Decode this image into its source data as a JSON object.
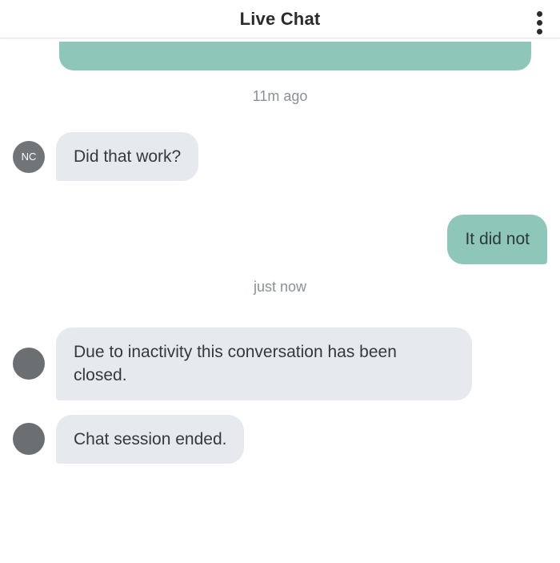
{
  "header": {
    "title": "Live Chat"
  },
  "timestamps": {
    "first": "11m ago",
    "second": "just now"
  },
  "avatars": {
    "agent_initials": "NC"
  },
  "messages": {
    "agent_q": "Did that work?",
    "user_reply": "It did not",
    "system_inactive": "Due to inactivity this conversation has been closed.",
    "system_ended": "Chat session ended."
  }
}
